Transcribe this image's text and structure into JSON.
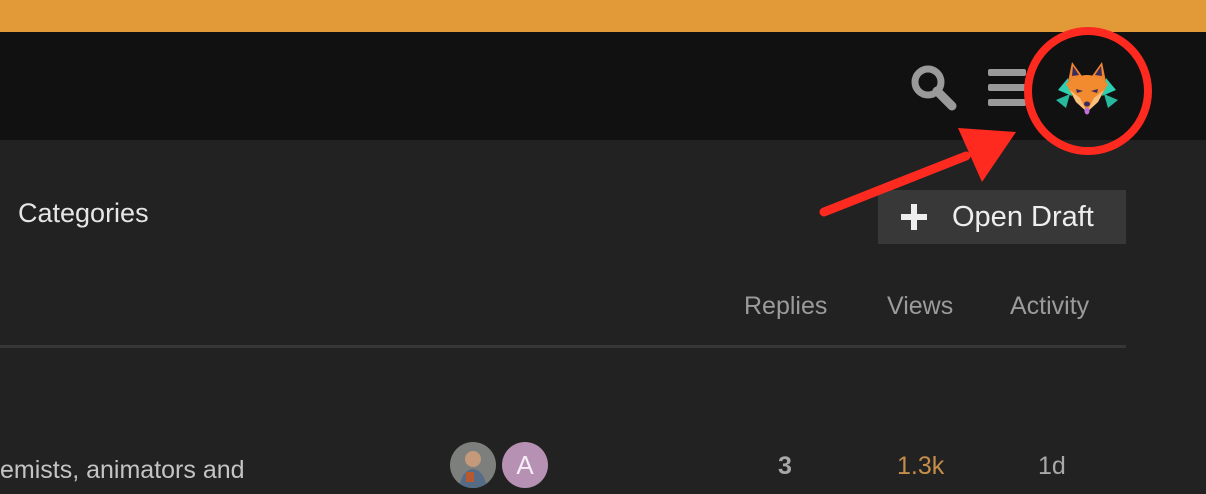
{
  "header": {
    "top_bar_color": "#e29a38",
    "icons": [
      "search-icon",
      "hamburger-menu-icon",
      "user-avatar-fox"
    ]
  },
  "nav": {
    "categories_label": "Categories"
  },
  "toolbar": {
    "open_draft_label": "Open Draft",
    "open_draft_icon": "plus-icon"
  },
  "topic_list": {
    "columns": [
      "Replies",
      "Views",
      "Activity"
    ],
    "rows": [
      {
        "excerpt": "emists, animators and",
        "posters": [
          {
            "type": "photo"
          },
          {
            "type": "letter",
            "letter": "A",
            "color": "#b691b4"
          }
        ],
        "replies": "3",
        "views": "1.3k",
        "activity": "1d"
      }
    ]
  },
  "annotation": {
    "color": "#ff2a1f",
    "shapes": [
      "circle-around-avatar",
      "arrow-pointing-to-avatar"
    ]
  }
}
